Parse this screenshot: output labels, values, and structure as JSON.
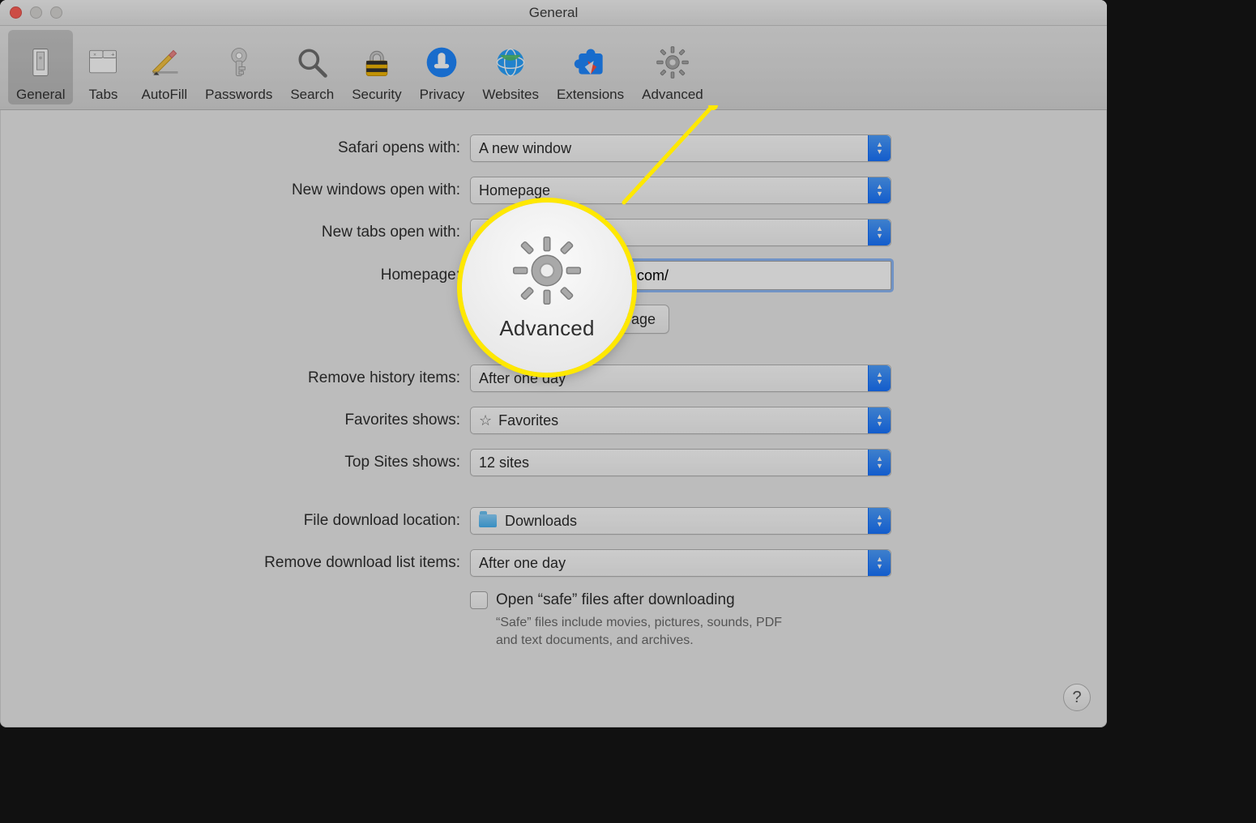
{
  "window": {
    "title": "General"
  },
  "toolbar": {
    "items": [
      {
        "label": "General"
      },
      {
        "label": "Tabs"
      },
      {
        "label": "AutoFill"
      },
      {
        "label": "Passwords"
      },
      {
        "label": "Search"
      },
      {
        "label": "Security"
      },
      {
        "label": "Privacy"
      },
      {
        "label": "Websites"
      },
      {
        "label": "Extensions"
      },
      {
        "label": "Advanced"
      }
    ]
  },
  "form": {
    "safari_opens_with": {
      "label": "Safari opens with:",
      "value": "A new window"
    },
    "new_windows_open_with": {
      "label": "New windows open with:",
      "value": "Homepage"
    },
    "new_tabs_open_with": {
      "label": "New tabs open with:",
      "value": ""
    },
    "homepage": {
      "label": "Homepage:",
      "value_visible": "e.com/"
    },
    "set_current_page": {
      "label": "Page"
    },
    "remove_history": {
      "label": "Remove history items:",
      "value": "After one day"
    },
    "favorites_shows": {
      "label": "Favorites shows:",
      "value": "Favorites"
    },
    "top_sites_shows": {
      "label": "Top Sites shows:",
      "value": "12 sites"
    },
    "download_location": {
      "label": "File download location:",
      "value": "Downloads"
    },
    "remove_download_list": {
      "label": "Remove download list items:",
      "value": "After one day"
    },
    "open_safe_files": {
      "label": "Open “safe” files after downloading",
      "hint": "“Safe” files include movies, pictures, sounds, PDF and text documents, and archives."
    }
  },
  "spotlight": {
    "label": "Advanced"
  },
  "help": {
    "glyph": "?"
  }
}
